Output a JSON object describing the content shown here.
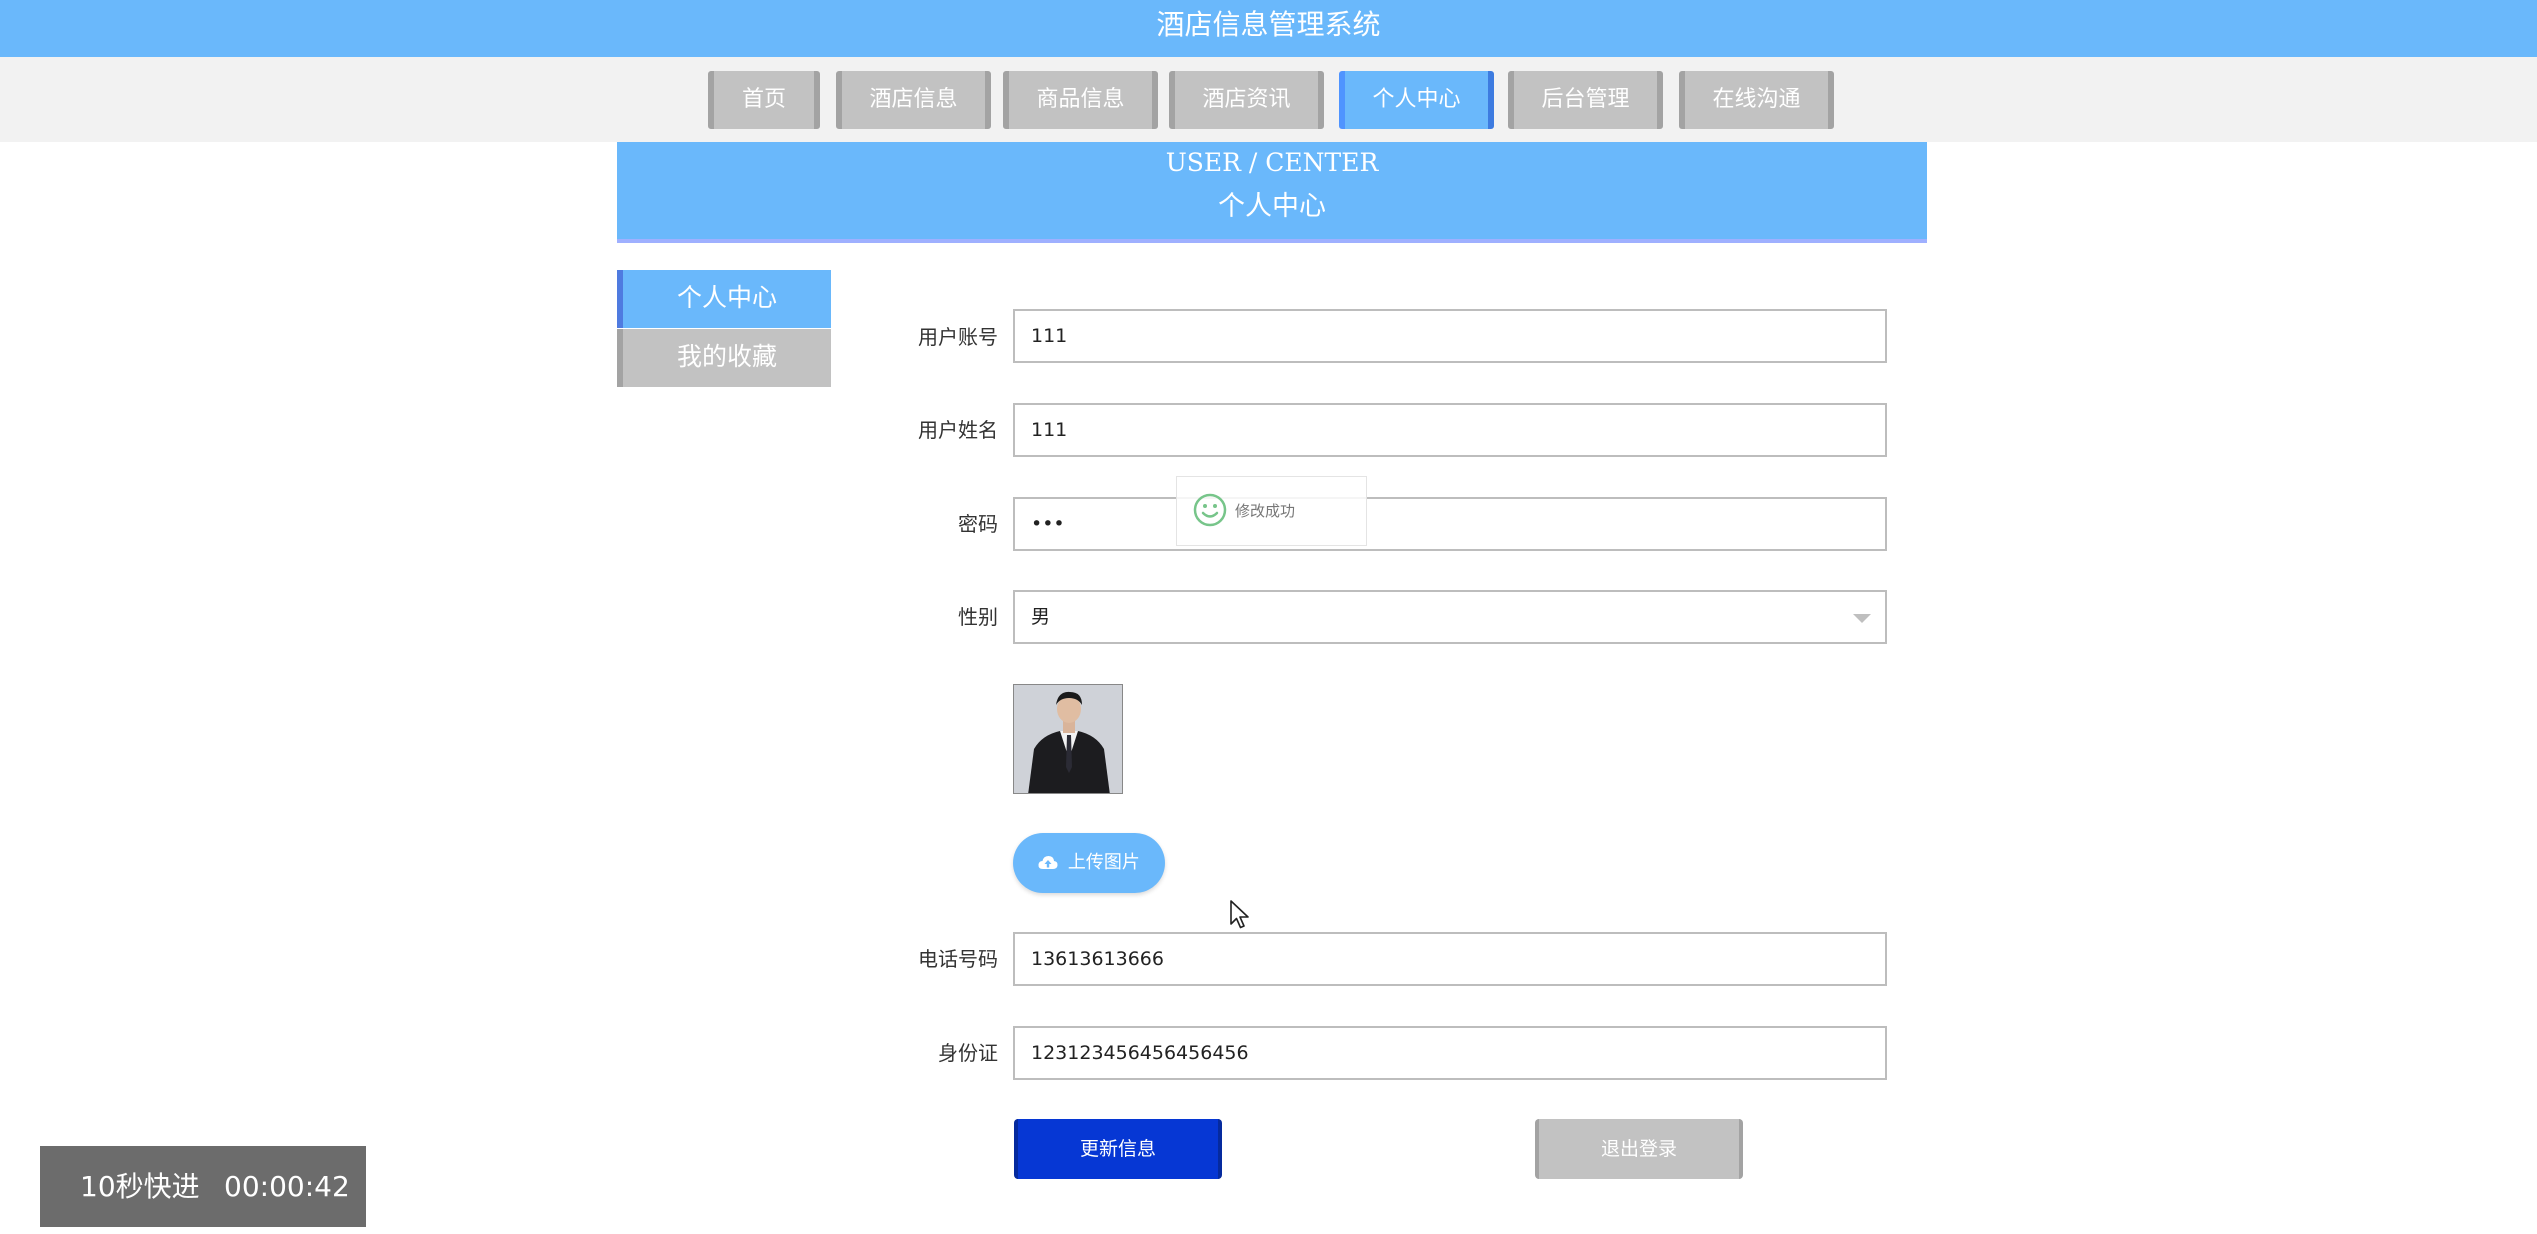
{
  "app": {
    "title": "酒店信息管理系统"
  },
  "nav": {
    "items": [
      {
        "label": "首页"
      },
      {
        "label": "酒店信息"
      },
      {
        "label": "商品信息"
      },
      {
        "label": "酒店资讯"
      },
      {
        "label": "个人中心",
        "active": true
      },
      {
        "label": "后台管理"
      },
      {
        "label": "在线沟通"
      }
    ]
  },
  "banner": {
    "en": "USER / CENTER",
    "zh": "个人中心"
  },
  "sidebar": {
    "items": [
      {
        "label": "个人中心",
        "active": true
      },
      {
        "label": "我的收藏"
      }
    ]
  },
  "form": {
    "account": {
      "label": "用户账号",
      "value": "111"
    },
    "name": {
      "label": "用户姓名",
      "value": "111"
    },
    "password": {
      "label": "密码",
      "value": "•••"
    },
    "gender": {
      "label": "性别",
      "value": "男"
    },
    "upload_label": "上传图片",
    "phone": {
      "label": "电话号码",
      "value": "13613613666"
    },
    "id_card": {
      "label": "身份证",
      "value": "123123456456456456"
    },
    "update_label": "更新信息",
    "logout_label": "退出登录"
  },
  "toast": {
    "message": "修改成功"
  },
  "player": {
    "fast_forward_label": "10秒快进",
    "timestamp": "00:00:42"
  },
  "colors": {
    "accent": "#6ab8fb",
    "nav_inactive": "#c2c2c2",
    "primary_button": "#0637d4",
    "overlay": "#6c6c6c"
  },
  "icons": [
    "cloud-upload-icon",
    "smiley-icon",
    "chevron-down-icon",
    "cursor-icon"
  ]
}
